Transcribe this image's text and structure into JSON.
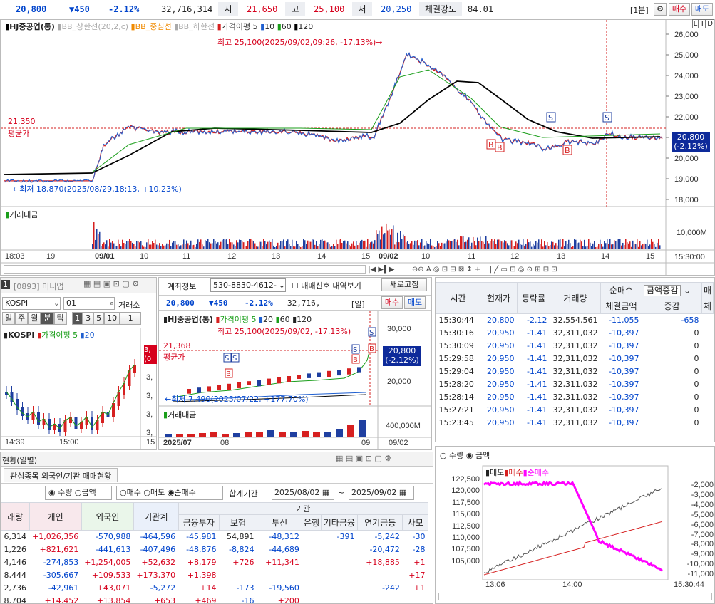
{
  "quote": {
    "price": "20,800",
    "change": "▼450",
    "pct": "-2.12%",
    "volume": "32,716,314",
    "open_l": "시",
    "open": "21,650",
    "high_l": "고",
    "high": "25,100",
    "low_l": "저",
    "low": "20,250",
    "str_l": "체결강도",
    "str": "84.01",
    "period": "[1분]",
    "buy": "매수",
    "sell": "매도"
  },
  "main_chart": {
    "legend": [
      "HJ중공업(통)",
      "BB_상한선(20,2,c)",
      "BB_중심선",
      "BB_하한선",
      "가격이평 5",
      "10",
      "60",
      "120"
    ],
    "yticks": [
      "26,000",
      "25,000",
      "24,000",
      "23,000",
      "22,000",
      "21,000",
      "20,000",
      "19,000",
      "18,000"
    ],
    "high_note": "최고 25,100(2025/09/02,09:26, -17.13%)→",
    "low_note": "←최저 18,870(2025/08/29,18:13, +10.23%)",
    "avg_price": "21,350",
    "avg_label": "평균가",
    "cur_price": "20,800",
    "cur_pct": "(-2.12%)",
    "vol_label": "거래대금",
    "vol_tick": "10,000M",
    "xticks": [
      "18:03",
      "19",
      "09/01",
      "10",
      "11",
      "12",
      "13",
      "14",
      "15",
      "09/02",
      "10",
      "11",
      "12",
      "13",
      "14",
      "15"
    ],
    "time_end": "15:30:00",
    "markers": {
      "s": "S",
      "b": "B"
    },
    "box_icons": [
      "L",
      "T",
      "D"
    ],
    "toolbar": "|◀ ▶▌▶ ─── ⊖⊕ A ◎ ⊡ ⊞ ⊠ ↕ + ─ | ╱ ▭ ⊡ ◎ ⊙ ⊞ ⊟ ⊡"
  },
  "price_ticks": [
    22770,
    23150,
    23860,
    23670,
    24120,
    24310,
    25000,
    25040,
    24820,
    24740,
    24220,
    24330,
    24010,
    23540,
    23310,
    22640,
    21950,
    21890,
    21640,
    21390,
    21180,
    21160,
    20940,
    21030,
    20770,
    20940,
    21000,
    20920,
    20940,
    20880,
    20810,
    20640,
    20780,
    21260,
    20870,
    20930,
    20830,
    20850,
    20820,
    20800
  ],
  "mini": {
    "tag": "1",
    "code": "[0893] 미니업",
    "kospi": "KOSPI",
    "no": "01",
    "market": "거래소",
    "periods": [
      "일",
      "주",
      "월",
      "분",
      "틱"
    ],
    "nums": [
      "1",
      "3",
      "5",
      "10",
      "1"
    ],
    "legend": [
      "KOSPI",
      "가격이평 5",
      "20"
    ],
    "yvals": [
      "3,",
      "3,",
      "3,",
      "3,",
      "3,",
      "3,"
    ],
    "cur": "3,",
    "cur2": "(0",
    "x": [
      "14:39",
      "15:00",
      "15"
    ]
  },
  "order": {
    "acct_l": "계좌정보",
    "acct": "530-8830-4612-",
    "chk": "매매신호 내역보기",
    "refresh": "새로고침",
    "price": "20,800",
    "change": "▼450",
    "pct": "-2.12%",
    "vol": "32,716,",
    "unit": "[일]",
    "buy": "매수",
    "sell": "매도",
    "legend": [
      "HJ중공업(통)",
      "가격이평 5",
      "20",
      "60",
      "120"
    ],
    "yticks": [
      "30,000",
      "20,000"
    ],
    "high_note": "최고 25,100(2025/09/02, -17.13%)",
    "avg_price": "21,368",
    "avg_label": "평균가",
    "low_note": "←최저 7,490(2025/07/22, +177.70%)",
    "cur_price": "20,800",
    "cur_pct": "(-2.12%)",
    "vol_label": "거래대금",
    "vol_tick": "400,000M",
    "x": [
      "2025/07",
      "08",
      "09",
      "09/02"
    ]
  },
  "ticks_table": {
    "headers": [
      "시간",
      "현재가",
      "등락률",
      "거래량",
      "순매수",
      "체결금액",
      "증감",
      "매"
    ],
    "sub": "체",
    "select": "금액증감",
    "rows": [
      [
        "15:30:44",
        "20,800",
        "-2.12",
        "32,554,561",
        "-11,055",
        "-658"
      ],
      [
        "15:30:16",
        "20,950",
        "-1.41",
        "32,311,032",
        "-10,397",
        "0"
      ],
      [
        "15:30:09",
        "20,950",
        "-1.41",
        "32,311,032",
        "-10,397",
        "0"
      ],
      [
        "15:29:58",
        "20,950",
        "-1.41",
        "32,311,032",
        "-10,397",
        "0"
      ],
      [
        "15:29:04",
        "20,950",
        "-1.41",
        "32,311,032",
        "-10,397",
        "0"
      ],
      [
        "15:28:20",
        "20,950",
        "-1.41",
        "32,311,032",
        "-10,397",
        "0"
      ],
      [
        "15:28:14",
        "20,950",
        "-1.41",
        "32,311,032",
        "-10,397",
        "0"
      ],
      [
        "15:27:21",
        "20,950",
        "-1.41",
        "32,311,032",
        "-10,397",
        "0"
      ],
      [
        "15:23:45",
        "20,950",
        "-1.41",
        "32,311,032",
        "-10,397",
        "0"
      ]
    ]
  },
  "flow_chart": {
    "radio": [
      "수량",
      "금액"
    ],
    "legend": [
      "매도",
      "매수",
      "순매수"
    ],
    "left": [
      "122,500",
      "120,000",
      "117,500",
      "115,000",
      "112,500",
      "110,000",
      "107,500",
      "105,000"
    ],
    "right": [
      "-2,000",
      "-3,000",
      "-4,000",
      "-5,000",
      "-6,000",
      "-7,000",
      "-8,000",
      "-9,000",
      "-10,000",
      "-11,000"
    ],
    "x": [
      "13:06",
      "14:00"
    ],
    "end": "15:30:44"
  },
  "investor": {
    "title": "현황(일별)",
    "tab": "관심종목 외국인/기관 매매현황",
    "radios1": [
      "수량",
      "금액"
    ],
    "radios2": [
      "매수",
      "매도",
      "순매수"
    ],
    "period_l": "합계기간",
    "from": "2025/08/02",
    "to": "2025/09/02",
    "inst": "기관",
    "headers": [
      "래량",
      "개인",
      "외국인",
      "기관계",
      "금융투자",
      "보험",
      "투신",
      "은행",
      "기타금융",
      "연기금등",
      "사모"
    ],
    "rows": [
      [
        "6,314",
        "+1,026,356",
        "-570,988",
        "-464,596",
        "-45,981",
        "54,891",
        "-48,312",
        "",
        "-391",
        "-5,242",
        "-30"
      ],
      [
        "1,226",
        "+821,621",
        "-441,613",
        "-407,496",
        "-48,876",
        "-8,824",
        "-44,689",
        "",
        "",
        "-20,472",
        "-28"
      ],
      [
        "4,146",
        "-274,853",
        "+1,254,005",
        "+52,632",
        "+8,179",
        "+726",
        "+11,341",
        "",
        "",
        "+18,885",
        "+1"
      ],
      [
        "8,444",
        "-305,667",
        "+109,533",
        "+173,370",
        "+1,398",
        "",
        "",
        "",
        "",
        "",
        "+17"
      ],
      [
        "2,736",
        "-42,961",
        "+43,071",
        "-5,272",
        "+14",
        "-173",
        "-19,560",
        "",
        "",
        "-242",
        "+1"
      ],
      [
        "8,704",
        "+14,452",
        "+13,854",
        "+653",
        "+469",
        "-16",
        "+200",
        "",
        "",
        "",
        ""
      ]
    ]
  },
  "colors": {
    "up": "#d6001c",
    "down": "#0044cc",
    "magenta": "#ff00ff",
    "ma5": "#d62020",
    "ma20": "#f08a00",
    "ma60": "#1a9e1a",
    "ma120": "#000000"
  }
}
